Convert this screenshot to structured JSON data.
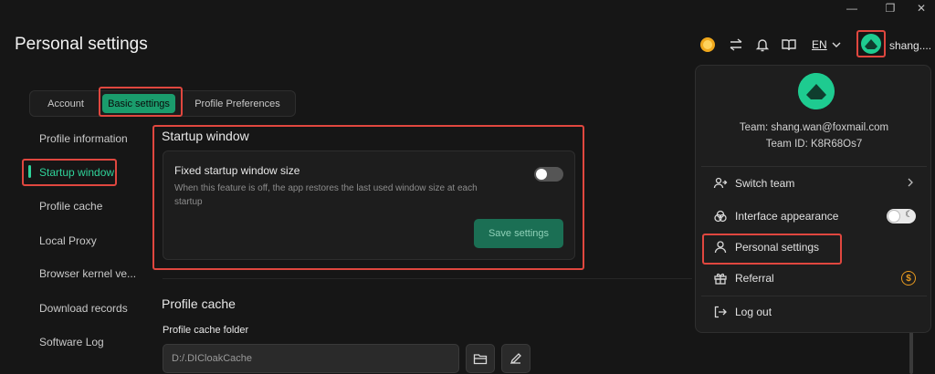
{
  "window": {
    "minimize_glyph": "—",
    "maximize_glyph": "❐",
    "close_glyph": "✕"
  },
  "page": {
    "title": "Personal settings"
  },
  "header": {
    "language": "EN",
    "username": "shang....",
    "icons": [
      "coin-icon",
      "switch-icon",
      "bell-icon",
      "book-icon",
      "chevron-down-icon"
    ]
  },
  "tabs": [
    {
      "label": "Account",
      "active": false
    },
    {
      "label": "Basic settings",
      "active": true
    },
    {
      "label": "Profile Preferences",
      "active": false
    }
  ],
  "sidebar": {
    "items": [
      {
        "label": "Profile information"
      },
      {
        "label": "Startup window",
        "active": true
      },
      {
        "label": "Profile cache"
      },
      {
        "label": "Local Proxy"
      },
      {
        "label": "Browser kernel ve..."
      },
      {
        "label": "Download records"
      },
      {
        "label": "Software Log"
      }
    ]
  },
  "startup": {
    "section_title": "Startup window",
    "setting_label": "Fixed startup window size",
    "setting_desc": "When this feature is off, the app restores the last used window size at each startup",
    "toggle_on": false,
    "save_label": "Save settings"
  },
  "cache": {
    "section_title": "Profile cache",
    "folder_label": "Profile cache folder",
    "folder_value": "D:/.DICloakCache"
  },
  "dropdown": {
    "team_email": "Team: shang.wan@foxmail.com",
    "team_id": "Team ID: K8R68Os7",
    "items": [
      {
        "label": "Switch team"
      },
      {
        "label": "Interface appearance"
      },
      {
        "label": "Personal settings"
      },
      {
        "label": "Referral"
      },
      {
        "label": "Log out"
      }
    ],
    "referral_badge": "$",
    "theme_glyph": "☾"
  },
  "colors": {
    "accent": "#1ecb90",
    "highlight": "#e0473f",
    "background": "#161616"
  }
}
